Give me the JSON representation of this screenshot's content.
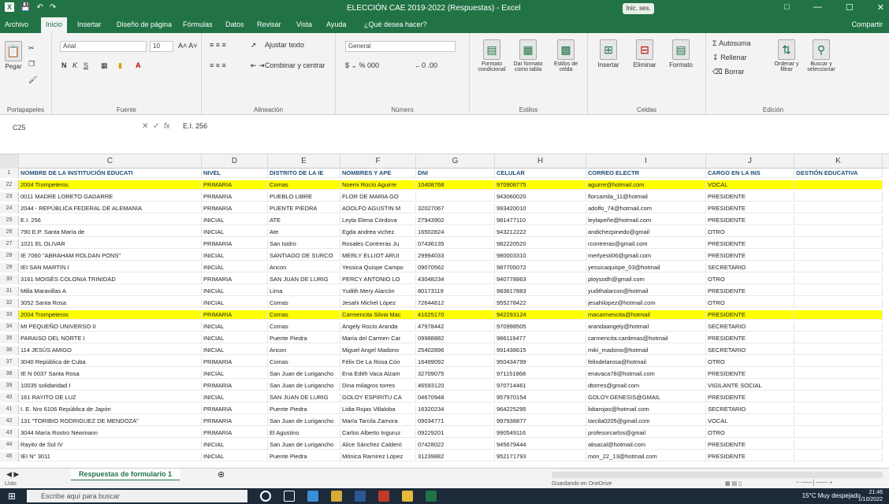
{
  "window": {
    "title": "ELECCIÓN CAE 2019-2022 (Respuestas) - Excel",
    "search_btn": "Inic. ses.",
    "share": "Compartir"
  },
  "tabs": [
    "Archivo",
    "Inicio",
    "Insertar",
    "Diseño de página",
    "Fórmulas",
    "Datos",
    "Revisar",
    "Vista",
    "Ayuda",
    "¿Qué desea hacer?"
  ],
  "ribbon": {
    "paste": "Pegar",
    "font_name": "Arial",
    "font_size": "10",
    "wrap": "Ajustar texto",
    "merge": "Combinar y centrar",
    "number_format": "General",
    "cond_format": "Formato condicional",
    "table_format": "Dar formato como tabla",
    "cell_styles": "Estilos de celda",
    "insert": "Insertar",
    "delete": "Eliminar",
    "format": "Formato",
    "autosum": "Autosuma",
    "fill": "Rellenar",
    "clear": "Borrar",
    "sort": "Ordenar y filtrar",
    "find": "Buscar y seleccionar",
    "groups": [
      "Portapapeles",
      "Fuente",
      "Alineación",
      "Número",
      "Estilos",
      "Celdas",
      "Edición"
    ]
  },
  "formula_bar": {
    "cell": "C25",
    "value": "E.I. 256"
  },
  "columns": [
    "C",
    "D",
    "E",
    "F",
    "G",
    "H",
    "I",
    "J",
    "K"
  ],
  "header_row": {
    "num": "1",
    "cells": [
      "NOMBRE DE LA INSTITUCIÓN EDUCATI",
      "NIVEL",
      "DISTRITO DE LA IE",
      "NOMBRES Y APE",
      "DNI",
      "CELULAR",
      "CORREO ELECTR",
      "CARGO EN LA INS",
      "GESTIÓN EDUCATIVA"
    ]
  },
  "rows": [
    {
      "num": "22",
      "hl": true,
      "cells": [
        "2004 Trompeteros",
        "PRIMARIA",
        "Comas",
        "Noemi Rocío Aguirre",
        "10408768",
        "970908775",
        "aguirre@hotmail.com",
        "VOCAL",
        ""
      ]
    },
    {
      "num": "23",
      "hl": false,
      "cells": [
        "0011 MADRE LORETO GADARRE",
        "PRIMARIA",
        "PUEBLO LIBRE",
        "FLOR DE MARIA GO",
        "",
        "943060020",
        "florcamila_11@hotmail",
        "PRESIDENTE",
        ""
      ]
    },
    {
      "num": "24",
      "hl": false,
      "cells": [
        "2044 - REPÚBLICA FEDERAL DE ALEMANIA",
        "PRIMARIA",
        "PUENTE PIEDRA",
        "ADOLFO AGUSTIN M",
        "32027067",
        "993420010",
        "adolfo_74@hotmail.com",
        "PRESIDENTE",
        ""
      ]
    },
    {
      "num": "25",
      "hl": false,
      "cells": [
        "E.I. 256",
        "INICIAL",
        "ATE",
        "Leyla Elena Córdova",
        "27943902",
        "981477110",
        "leylapeñe@hotmail.com",
        "PRESIDENTE",
        ""
      ]
    },
    {
      "num": "26",
      "hl": false,
      "cells": [
        "790 E.P. Santa María de",
        "INICIAL",
        "Ate",
        "Egda andrea vichez",
        "16502824",
        "943212222",
        "andichezpinedo@gmail",
        "OTRO",
        ""
      ]
    },
    {
      "num": "27",
      "hl": false,
      "cells": [
        "1021 EL OLIVAR",
        "PRIMARIA",
        "San Isidro",
        "Rosales Contreras Ju",
        "07436135",
        "982220520",
        "rcontreras@gmail.com",
        "PRESIDENTE",
        ""
      ]
    },
    {
      "num": "28",
      "hl": false,
      "cells": [
        "IE 7060 \"ABRAHAM ROLDAN PONS\"",
        "INICIAL",
        "SANTIAGO DE SURCO",
        "MERLY ELLIOT ARUI",
        "29994033",
        "980003310",
        "merlyesti06@gmail.com",
        "PRESIDENTE",
        ""
      ]
    },
    {
      "num": "29",
      "hl": false,
      "cells": [
        "IEI SAN MARTIN I",
        "INICIAL",
        "Ancon",
        "Yessica Quispe Campo",
        "09070562",
        "987705072",
        "yessicaquispe_03@hotmail",
        "SECRETARIO",
        ""
      ]
    },
    {
      "num": "30",
      "hl": false,
      "cells": [
        "3161 MOISÉS COLONIA TRINIDAD",
        "PRIMARIA",
        "SAN JUAN DE LURIG",
        "PERCY ANTONIO LO",
        "43048234",
        "940778863",
        "ploysodh@gmail.com",
        "OTRO",
        ""
      ]
    },
    {
      "num": "31",
      "hl": false,
      "cells": [
        "Milla Maravillas A",
        "INICIAL",
        "Lima",
        "Yudith Mery Alarcón",
        "80173119",
        "983617883",
        "yudithalarcon@hotmail",
        "PRESIDENTE",
        ""
      ]
    },
    {
      "num": "32",
      "hl": false,
      "cells": [
        "3052 Santa Rosa",
        "INICIAL",
        "Comas",
        "Jesahi Michel López",
        "72644812",
        "955278422",
        "jesahilopez@hotmail.com",
        "OTRO",
        ""
      ]
    },
    {
      "num": "33",
      "hl": true,
      "cells": [
        "2004 Trompeteros",
        "PRIMARIA",
        "Comas",
        "Carmencita Silvia Mac",
        "41025170",
        "942293124",
        "macarmencita@hotmail",
        "PRESIDENTE",
        ""
      ]
    },
    {
      "num": "34",
      "hl": false,
      "cells": [
        "MI PEQUEÑO UNIVERSO II",
        "INICIAL",
        "Comas",
        "Angely Rocío Aranda",
        "47978442",
        "970998505",
        "arandaangely@hotmail",
        "SECRETARIO",
        ""
      ]
    },
    {
      "num": "35",
      "hl": false,
      "cells": [
        "PARAISO DEL NORTE I",
        "INICIAL",
        "Puente Piedra",
        "María del Carmen Car",
        "09988882",
        "986119477",
        "carmencita.cardenas@hotmail",
        "PRESIDENTE",
        ""
      ]
    },
    {
      "num": "36",
      "hl": false,
      "cells": [
        "114 JESÚS AMIGO",
        "INICIAL",
        "Ancon",
        "Miguel Angel Madono",
        "25402896",
        "991438615",
        "miki_madono@hotmail",
        "SECRETARIO",
        ""
      ]
    },
    {
      "num": "37",
      "hl": false,
      "cells": [
        "3040 República de Cuba",
        "PRIMARIA",
        "Comas",
        "Félix De La Rosa Cón",
        "16499092",
        "950434799",
        "felixdelarosa@hotmail",
        "OTRO",
        ""
      ]
    },
    {
      "num": "38",
      "hl": false,
      "cells": [
        "IE N 0037 Santa Rosa",
        "INICIAL",
        "San Juan de Lurigancho",
        "Ena Edith Vaca Alzam",
        "32709075",
        "971151868",
        "enavaca78@hotmail.com",
        "PRESIDENTE",
        ""
      ]
    },
    {
      "num": "39",
      "hl": false,
      "cells": [
        "10035 solidaridad I",
        "PRIMARIA",
        "San Juan de Lurigancho",
        "Dina milagros torres",
        "46593120",
        "970714461",
        "dtorres@gmail.com",
        "VIGILANTE SOCIAL",
        ""
      ]
    },
    {
      "num": "40",
      "hl": false,
      "cells": [
        "161 RAYITO DE LUZ",
        "INICIAL",
        "SAN JUAN DE LURIG",
        "GOLOY ESPIRITU CA",
        "04670948",
        "957970154",
        "GOLOY.GENESIS@GMAIL",
        "PRESIDENTE",
        ""
      ]
    },
    {
      "num": "41",
      "hl": false,
      "cells": [
        "I. E. Nro 6106 República de Japón",
        "PRIMARIA",
        "Puente Piedra",
        "Lidia Rojas Villaloba",
        "16320234",
        "964225295",
        "lidiarojas@hotmail.com",
        "SECRETARIO",
        ""
      ]
    },
    {
      "num": "42",
      "hl": false,
      "cells": [
        "131 \"TORIBIO RODRIGUEZ DE MENDOZA\"",
        "PRIMARIA",
        "San Juan de Lurigancho",
        "María Tarcila Zamora",
        "09034771",
        "997938877",
        "tarcila0205@gmail.com",
        "VOCAL",
        ""
      ]
    },
    {
      "num": "43",
      "hl": false,
      "cells": [
        "3044 María Rostro Newmann",
        "PRIMARIA",
        "El Agustino",
        "Carlos Alberto Inguruz",
        "09229201",
        "990549116",
        "profesorcarlos@gmail",
        "OTRO",
        ""
      ]
    },
    {
      "num": "44",
      "hl": false,
      "cells": [
        "Rayito de Sol IV",
        "INICIAL",
        "San Juan de Lurigancho",
        "Alice Sánchez Calderó",
        "07428022",
        "945679444",
        "alisacal@hotmail.com",
        "PRESIDENTE",
        ""
      ]
    },
    {
      "num": "45",
      "hl": false,
      "cells": [
        "IEI N° 3011",
        "INICIAL",
        "Puente Piedra",
        "Mónica Ramírez López",
        "31239882",
        "952171793",
        "mon_22_13@hotmail.com",
        "PRESIDENTE",
        ""
      ]
    }
  ],
  "sheet_tab": "Respuestas de formulario 1",
  "status": {
    "left": "Listo",
    "center": "Guardando en OneDrive"
  },
  "taskbar": {
    "search": "Escribe aquí para buscar",
    "weather": "15°C Muy despejado",
    "time": "21:46",
    "date": "1/10/2022"
  }
}
